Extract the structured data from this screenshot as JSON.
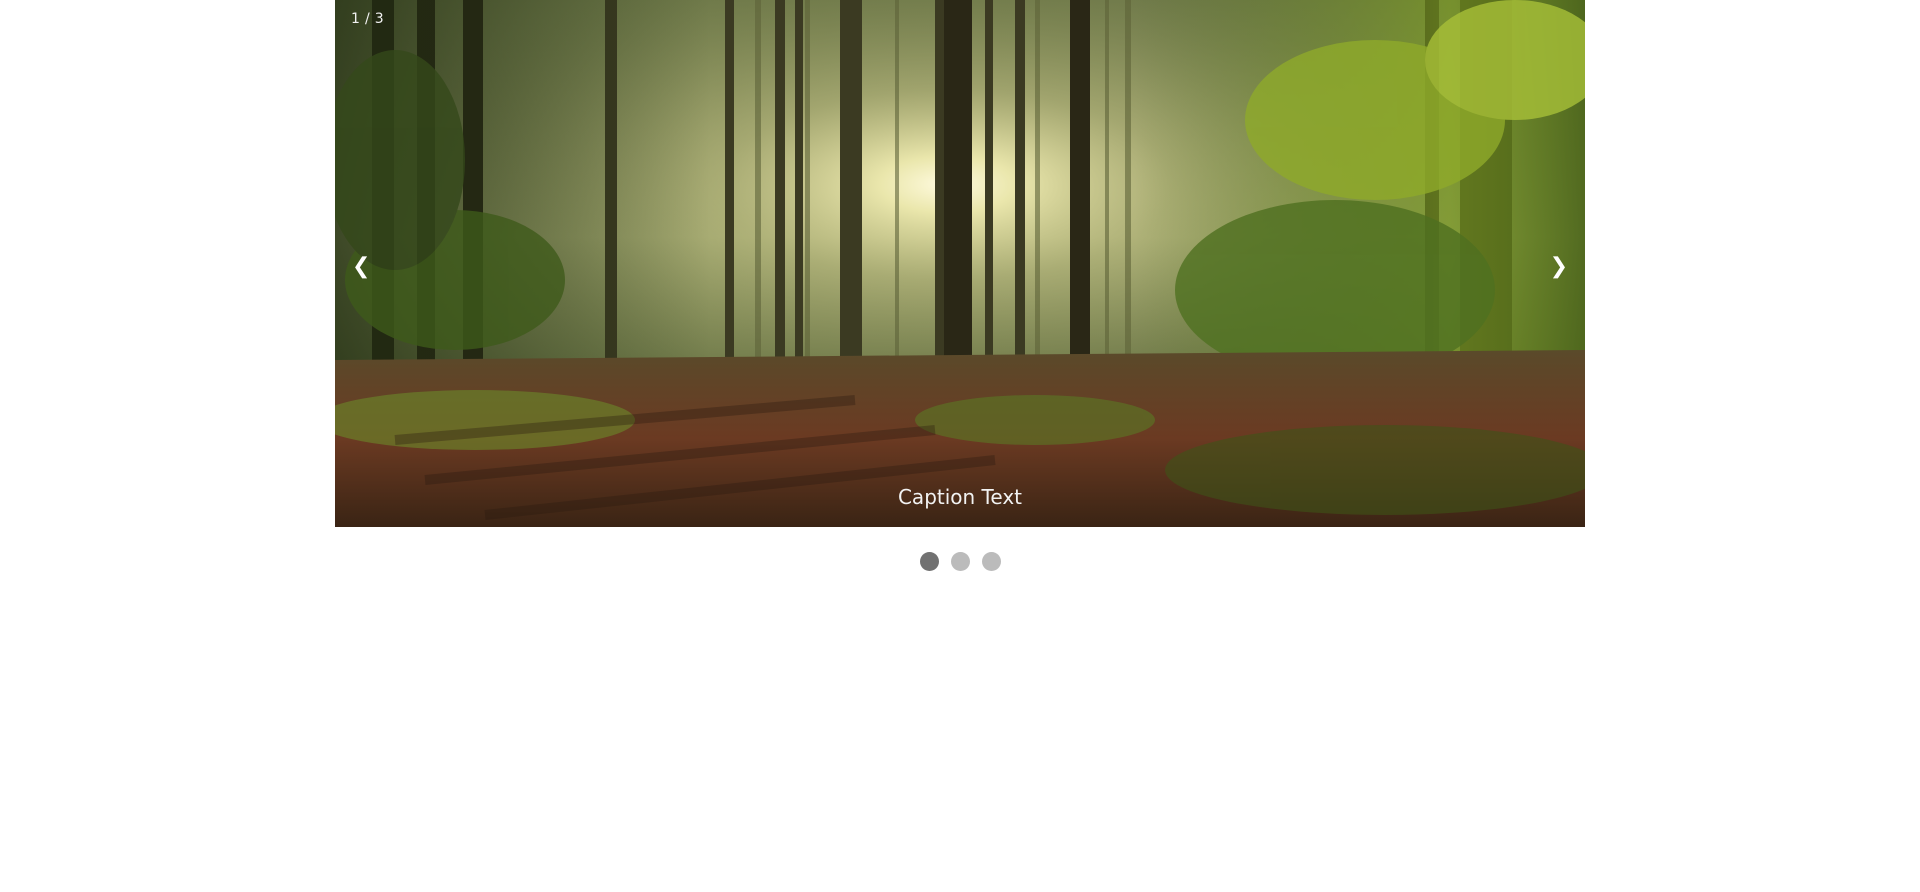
{
  "slideshow": {
    "counter": "1 / 3",
    "caption": "Caption Text",
    "prev_icon": "❮",
    "next_icon": "❯",
    "current_slide": 1,
    "total_slides": 3
  },
  "dots": [
    {
      "state": "active"
    },
    {
      "state": "inactive"
    },
    {
      "state": "inactive"
    }
  ],
  "colors": {
    "dot_active": "#717171",
    "dot_inactive": "#bbbbbb",
    "caption_text": "#f2f2f2"
  }
}
